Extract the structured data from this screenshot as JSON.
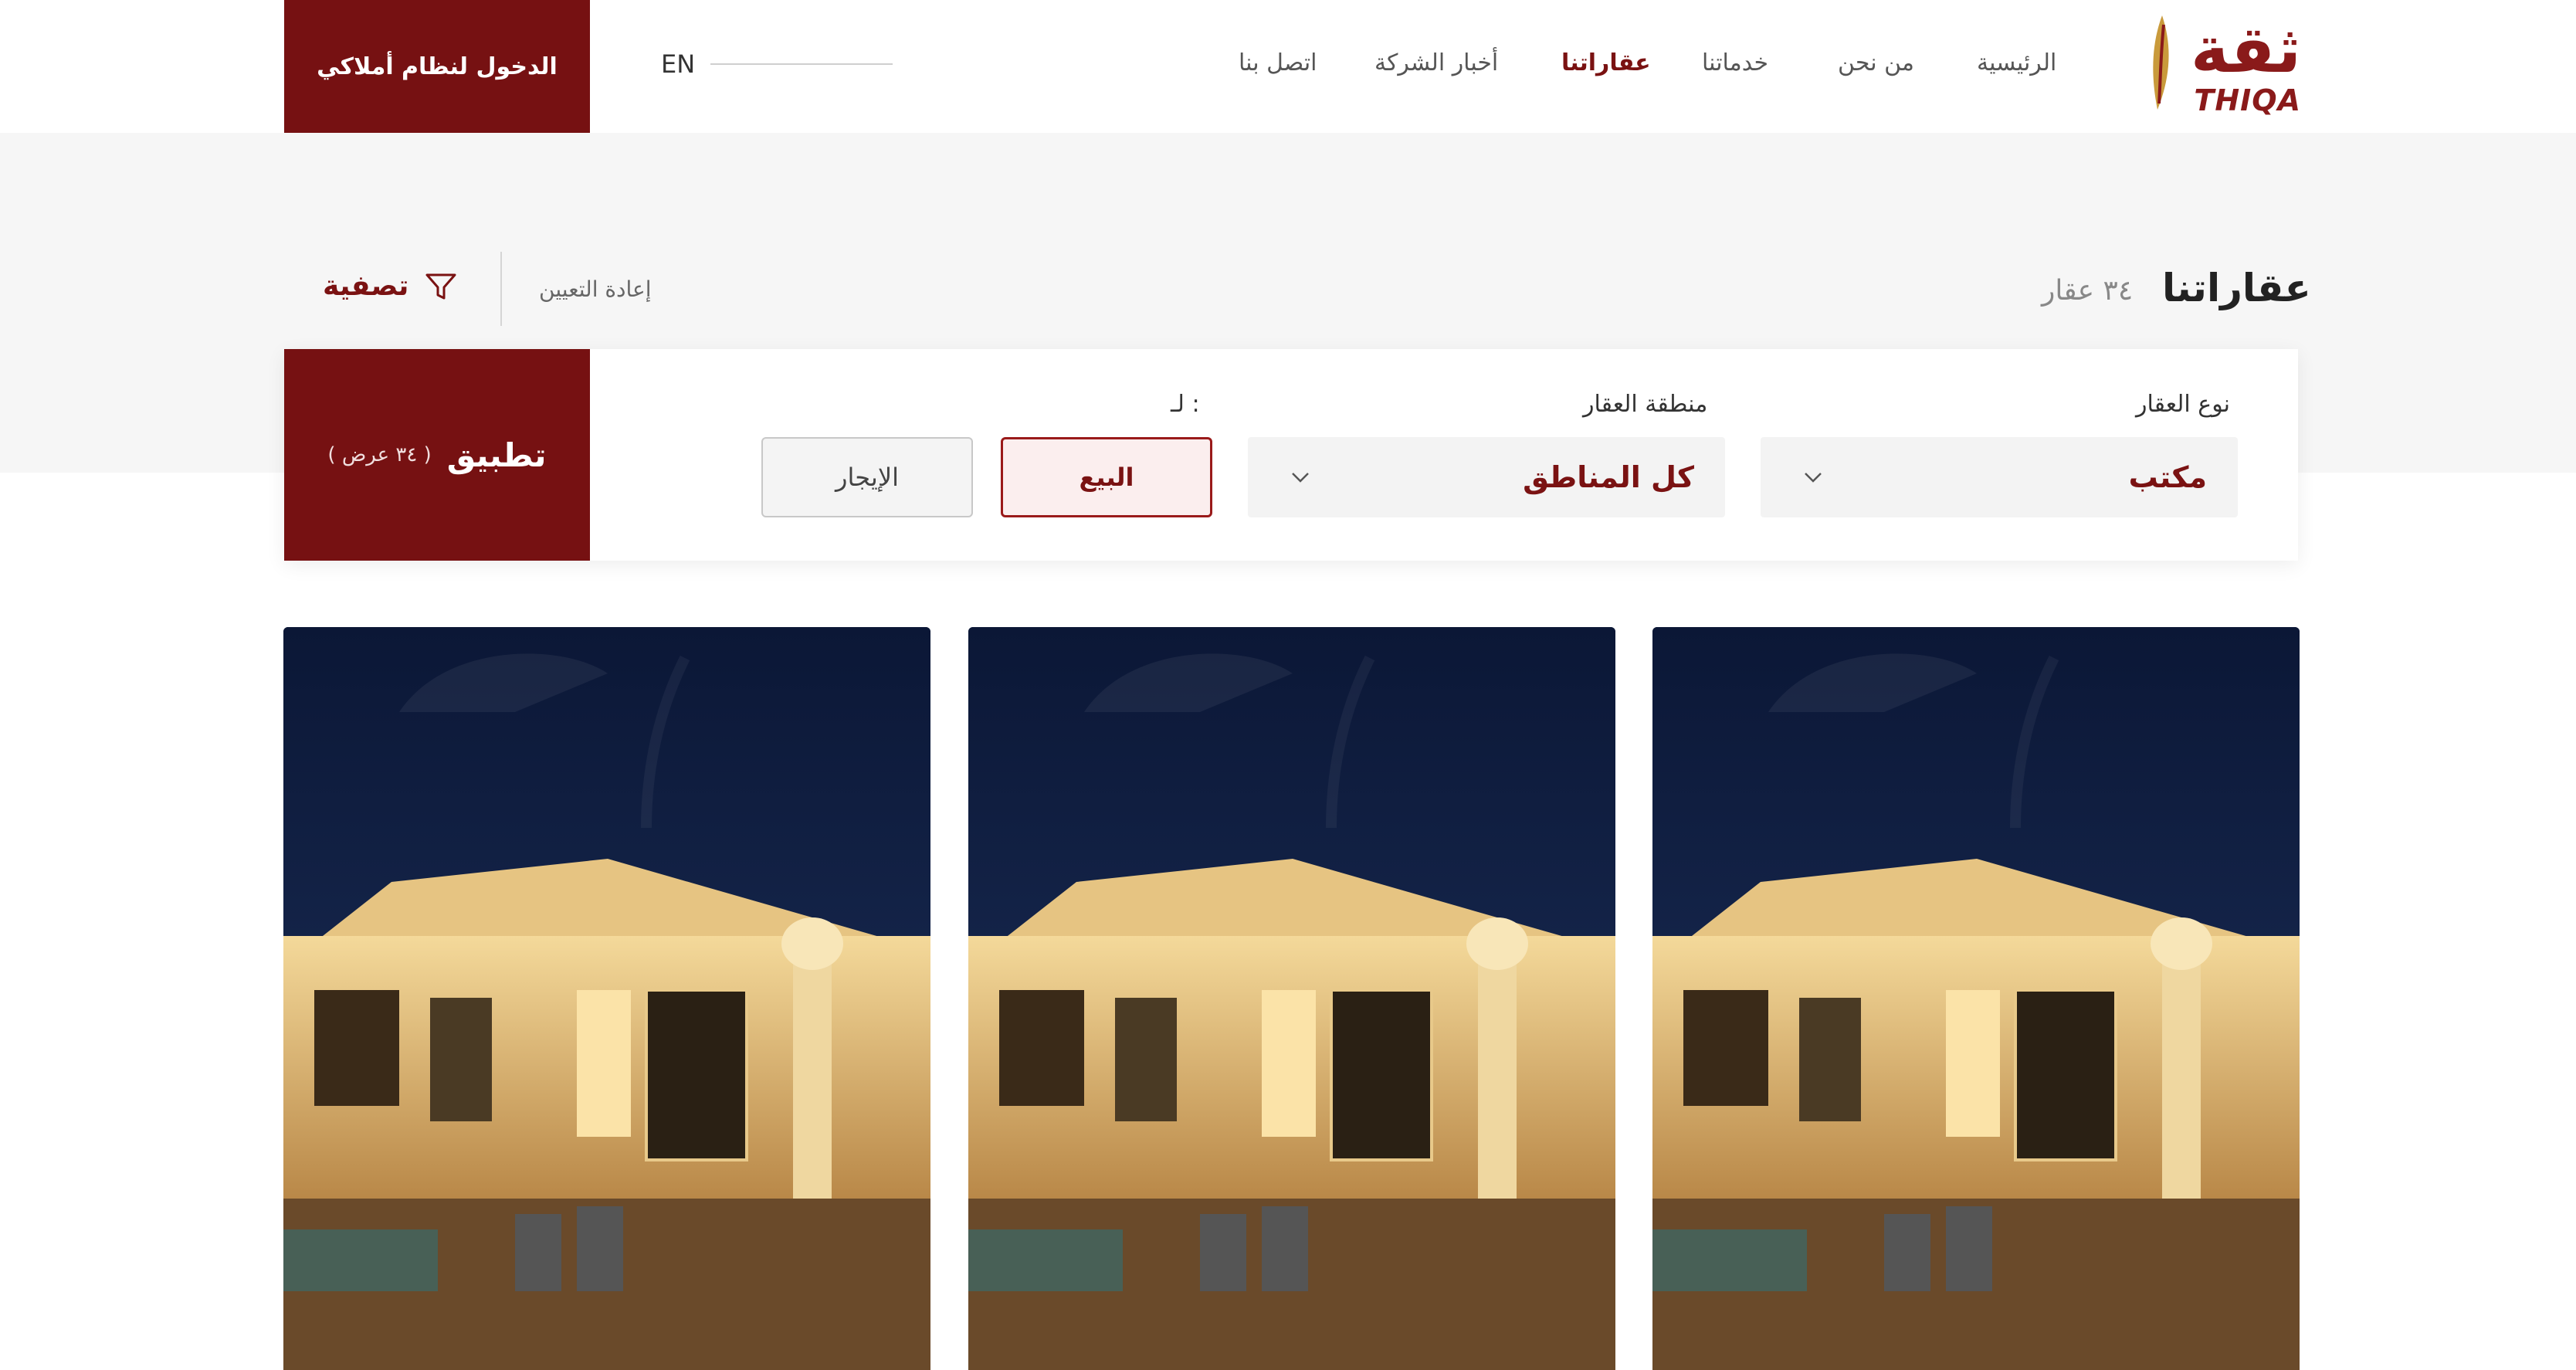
{
  "brand": {
    "logo_arabic": "ثقة",
    "logo_latin": "THIQA",
    "accent_color": "#761112"
  },
  "nav": {
    "items": [
      {
        "label": "الرئيسية",
        "active": false
      },
      {
        "label": "من نحن",
        "active": false
      },
      {
        "label": "خدماتنا",
        "active": false
      },
      {
        "label": "عقاراتنا",
        "active": true
      },
      {
        "label": "أخبار الشركة",
        "active": false
      },
      {
        "label": "اتصل بنا",
        "active": false
      }
    ],
    "language": "EN",
    "login_label": "الدخول لنظام أملاكي"
  },
  "listing": {
    "title": "عقاراتنا",
    "count": "٣٤ عقار",
    "filter_label": "تصفية",
    "reset_label": "إعادة التعيين"
  },
  "filters": {
    "property_type": {
      "label": "نوع العقار",
      "value": "مكتب"
    },
    "region": {
      "label": "منطقة العقار",
      "value": "كل المناطق"
    },
    "purpose": {
      "label": "لـ :",
      "options": [
        "البيع",
        "الإيجار"
      ],
      "selected": "البيع"
    },
    "apply_label": "تطبيق",
    "apply_count": "( ٣٤ عرض )"
  },
  "cards": [
    {
      "image": "villa-night-photo"
    },
    {
      "image": "villa-night-photo"
    },
    {
      "image": "villa-night-photo"
    }
  ],
  "icons": [
    "filter-icon",
    "chevron-down-icon",
    "logo-feather-icon"
  ]
}
